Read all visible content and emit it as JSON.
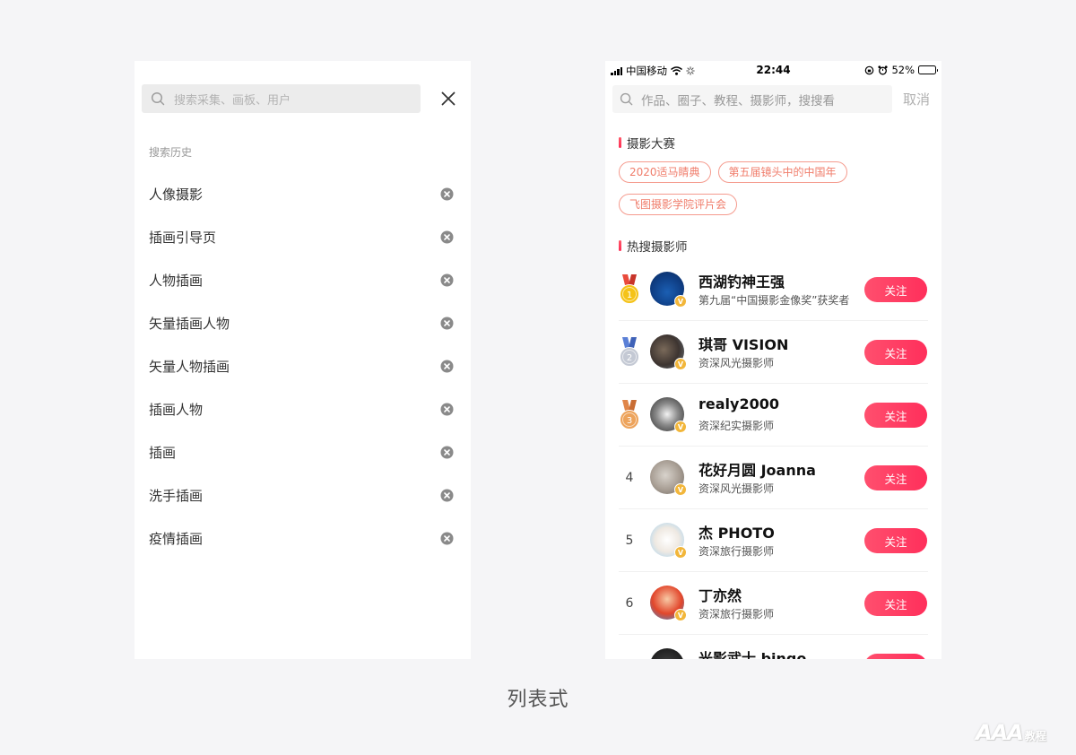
{
  "left": {
    "search_placeholder": "搜索采集、画板、用户",
    "history_title": "搜索历史",
    "history": [
      "人像摄影",
      "插画引导页",
      "人物插画",
      "矢量插画人物",
      "矢量人物插画",
      "插画人物",
      "插画",
      "洗手插画",
      "疫情插画"
    ]
  },
  "right": {
    "status": {
      "carrier": "中国移动",
      "time": "22:44",
      "battery": "52%",
      "battery_level": 0.52
    },
    "search_placeholder": "作品、圈子、教程、摄影师，搜搜看",
    "cancel": "取消",
    "contest_title": "摄影大赛",
    "tags": [
      "2020适马睛典",
      "第五届镜头中的中国年",
      "飞图摄影学院评片会"
    ],
    "hot_title": "热搜摄影师",
    "follow_label": "关注",
    "photographers": [
      {
        "rank": "1",
        "name": "西湖钓神王强",
        "desc": "第九届“中国摄影金像奖”获奖者",
        "medal": "gold"
      },
      {
        "rank": "2",
        "name": "琪哥 VISION",
        "desc": "资深风光摄影师",
        "medal": "silver"
      },
      {
        "rank": "3",
        "name": "realy2000",
        "desc": "资深纪实摄影师",
        "medal": "bronze"
      },
      {
        "rank": "4",
        "name": "花好月圆 Joanna",
        "desc": "资深风光摄影师",
        "medal": ""
      },
      {
        "rank": "5",
        "name": "杰 PHOTO",
        "desc": "资深旅行摄影师",
        "medal": ""
      },
      {
        "rank": "6",
        "name": "丁亦然",
        "desc": "资深旅行摄影师",
        "medal": ""
      },
      {
        "rank": "",
        "name": "光影武士 bingo",
        "desc": "",
        "medal": ""
      }
    ],
    "verified_mark": "V"
  },
  "caption": "列表式",
  "watermark": {
    "main": "AAA",
    "sub": "教程"
  },
  "colors": {
    "accent": "#ff3a62",
    "tag_border": "#f59b8e",
    "gold": "#f5c318",
    "silver": "#c4c9d4",
    "bronze": "#eda35b"
  }
}
